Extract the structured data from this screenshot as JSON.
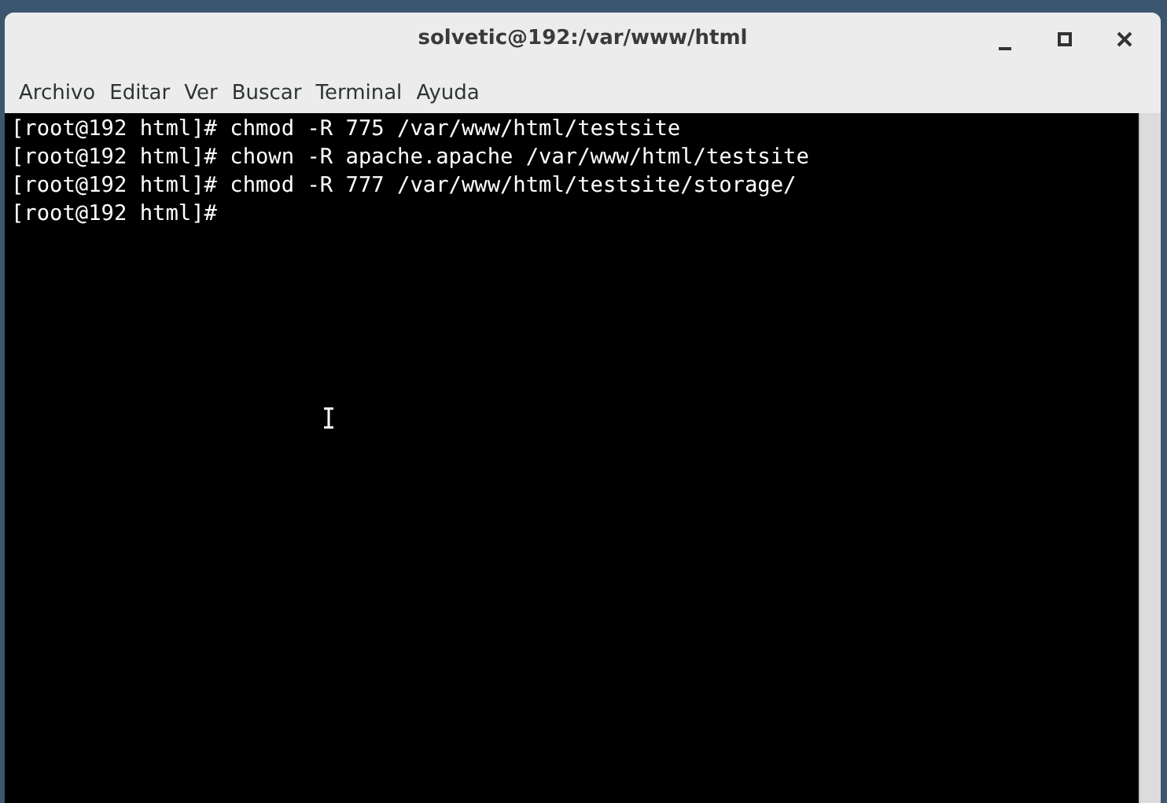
{
  "window": {
    "title": "solvetic@192:/var/www/html",
    "controls": [
      {
        "kind": "minimize"
      },
      {
        "kind": "maximize"
      },
      {
        "kind": "close"
      }
    ]
  },
  "menu": [
    "Archivo",
    "Editar",
    "Ver",
    "Buscar",
    "Terminal",
    "Ayuda"
  ],
  "terminal": {
    "lines": [
      "[root@192 html]# chmod -R 775 /var/www/html/testsite",
      "[root@192 html]# chown -R apache.apache /var/www/html/testsite",
      "[root@192 html]# chmod -R 777 /var/www/html/testsite/storage/",
      "[root@192 html]#"
    ]
  }
}
